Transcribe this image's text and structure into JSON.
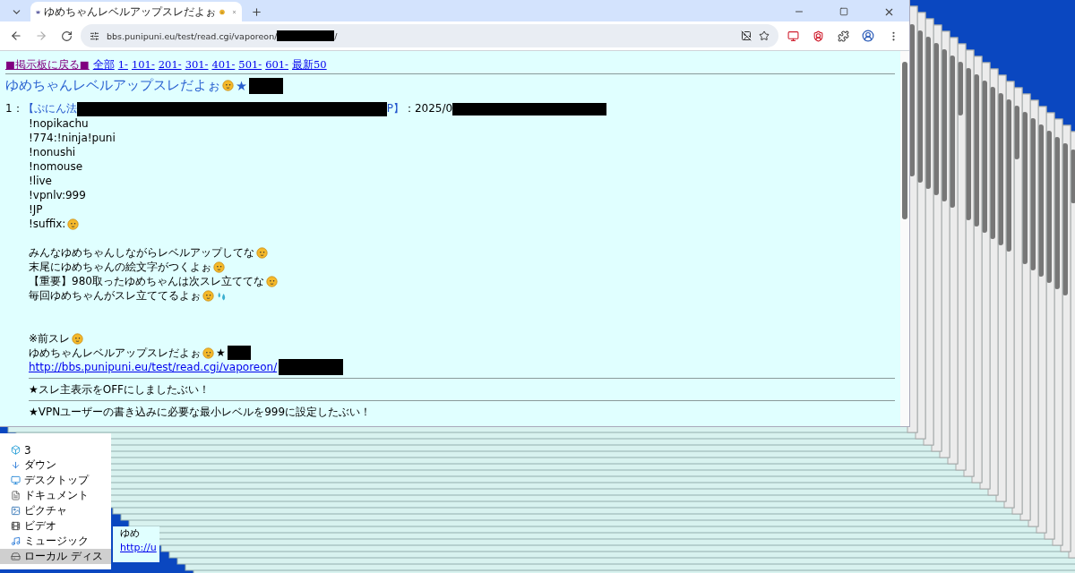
{
  "browser": {
    "tab": {
      "title": "ゆめちゃんレベルアップスレだよぉ",
      "selected": true
    },
    "address": {
      "prefix": "bbs.punipuni.eu/test/read.cgi/vaporeon/",
      "suffix": "/"
    }
  },
  "page": {
    "nav": [
      {
        "label": "■掲示板に戻る■",
        "visited": true
      },
      {
        "label": "全部",
        "visited": false
      },
      {
        "label": "1-",
        "visited": false
      },
      {
        "label": "101-",
        "visited": false
      },
      {
        "label": "201-",
        "visited": false
      },
      {
        "label": "301-",
        "visited": false
      },
      {
        "label": "401-",
        "visited": false
      },
      {
        "label": "501-",
        "visited": false
      },
      {
        "label": "601-",
        "visited": false
      },
      {
        "label": "最新50",
        "visited": false
      }
    ],
    "title": {
      "text": "ゆめちゃんレベルアップスレだよぉ",
      "star": "★"
    },
    "post": {
      "number": "1：",
      "name_start": "【ぷにん法",
      "name_end": "P】",
      "date": "：2025/0",
      "paragraphs": [
        [
          {
            "text": "!nopikachu",
            "kind": "plain"
          },
          {
            "text": "!774:!ninja!puni",
            "kind": "plain"
          },
          {
            "text": "!nonushi",
            "kind": "plain"
          },
          {
            "text": "!nomouse",
            "kind": "plain"
          },
          {
            "text": "!live",
            "kind": "plain"
          },
          {
            "text": "!vpnlv:999",
            "kind": "plain"
          },
          {
            "text": "!JP",
            "kind": "plain"
          },
          {
            "text": "!suffix:",
            "kind": "emoji"
          }
        ],
        [
          {
            "text": "みんなゆめちゃんしながらレベルアップしてな",
            "kind": "emoji"
          },
          {
            "text": "末尾にゆめちゃんの絵文字がつくよぉ",
            "kind": "emoji"
          },
          {
            "text": "【重要】980取ったゆめちゃんは次スレ立ててな",
            "kind": "emoji"
          },
          {
            "text": "毎回ゆめちゃんがスレ立ててるよぉ",
            "kind": "emoji_drops"
          }
        ],
        [
          {
            "text": "※前スレ",
            "kind": "emoji"
          },
          {
            "text": "ゆめちゃんレベルアップスレだよぉ",
            "kind": "emoji_star",
            "star": "★"
          },
          {
            "text": "http://bbs.punipuni.eu/test/read.cgi/vaporeon/",
            "kind": "link"
          }
        ]
      ],
      "notices": [
        "★スレ主表示をOFFにしましたぶい！",
        "★VPNユーザーの書き込みに必要な最小レベルを999に設定したぶい！"
      ]
    }
  },
  "explorer": {
    "items": [
      {
        "label": "3",
        "kind": "cube",
        "selected": false
      },
      {
        "label": "ダウン",
        "kind": "download",
        "selected": false
      },
      {
        "label": "デスクトップ",
        "kind": "desktop",
        "selected": false
      },
      {
        "label": "ドキュメント",
        "kind": "document",
        "selected": false
      },
      {
        "label": "ピクチャ",
        "kind": "picture",
        "selected": false
      },
      {
        "label": "ビデオ",
        "kind": "video",
        "selected": false
      },
      {
        "label": "ミュージック",
        "kind": "music",
        "selected": false
      },
      {
        "label": "ローカル ディス",
        "kind": "drive",
        "selected": true
      }
    ]
  },
  "behind_window": {
    "lines": [
      {
        "text": "ゆめ",
        "kind": "text"
      },
      {
        "text": "http://u",
        "kind": "link"
      }
    ]
  }
}
